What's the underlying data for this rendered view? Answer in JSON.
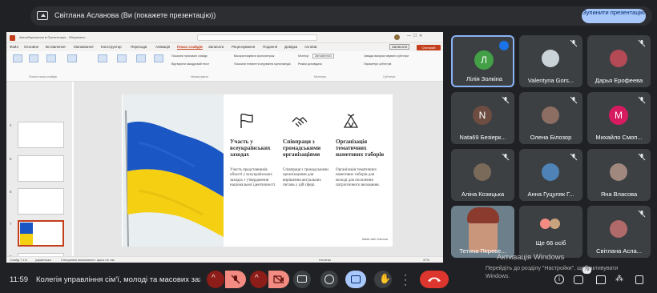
{
  "share_bar": {
    "presenter_text": "Світлана Асланова (Ви (покажете презентацію))",
    "stop_button": "Зупинити презентацію"
  },
  "powerpoint": {
    "title_text": "Автозбереження  ●  Презентація - Збережено",
    "menu": [
      "Файл",
      "Основне",
      "Вставлення",
      "Малювання",
      "Конструктор",
      "Переходи",
      "Анімація",
      "Показ слайдів",
      "Записати",
      "Рецензування",
      "Подання",
      "Довідка",
      "Acrobat"
    ],
    "active_menu": "Показ слайдів",
    "record_label": "Записати",
    "share_label": "Спільний доступ",
    "ribbon_groups": [
      "Почати показ слайдів",
      "Налаштувати",
      "Монітори",
      "Субтитри"
    ],
    "ribbon_options": [
      "Показати приховані слайди",
      "Використовувати хронометраж",
      "Монітор:",
      "Автоматично",
      "Завжди використовувати субтитри",
      "Відтворити закадровий текст",
      "Показати елементи керування мультимедіа",
      "Режим доповідача",
      "Параметри субтитрів"
    ],
    "status_left": "Слайд 7 з 8",
    "status_lang": "українська",
    "status_notes": "Нотатки",
    "status_access": "Спеціальні можливості: щось не так",
    "status_zoom": "47%",
    "thumb_numbers": [
      "4",
      "5",
      "6",
      "7",
      "8"
    ],
    "slide": {
      "columns": [
        {
          "icon": "flag-icon",
          "title": "Участь у всеукраїнських заходах",
          "body": "Участь представників області у всеукраїнських заходах з утвердження національної ідентичності."
        },
        {
          "icon": "handshake-icon",
          "title": "Співпраця з громадськими організаціями",
          "body": "Співпраця з громадськими організаціями для вирішення актуальних питань у цій сфері."
        },
        {
          "icon": "tent-icon",
          "title": "Організація тематичних наметових таборів",
          "body": "Організація тематичних наметових таборів для молоді для посилення патріотичного виховання."
        }
      ],
      "logo": "Made with Gamma"
    }
  },
  "participants": [
    {
      "name": "Лілія Золкіна",
      "initial": "Л",
      "avatar_color": "#43a047",
      "speaking": true
    },
    {
      "name": "Valentyna Gors...",
      "photo": true
    },
    {
      "name": "Дарья Ерофеева",
      "photo": true
    },
    {
      "name": "Nata69 Безіерк...",
      "initial": "N",
      "avatar_color": "#6d4c41"
    },
    {
      "name": "Олена Білозор",
      "photo": true
    },
    {
      "name": "Михайло Смоп...",
      "initial": "M",
      "avatar_color": "#d81b60"
    },
    {
      "name": "Аліна Козицька",
      "photo": true
    },
    {
      "name": "Анна Гуцуляк Г...",
      "photo": true
    },
    {
      "name": "Яна Власова",
      "photo": true
    },
    {
      "name": "Тетяна Переве...",
      "video": true
    },
    {
      "name": "Ще 66 осіб",
      "group": true
    },
    {
      "name": "Світлана Асла...",
      "photo": true
    }
  ],
  "bottom_bar": {
    "time": "11:59",
    "meeting_title": "Колегія управління сім'ї, молоді та масових зах...",
    "chat_badge": "79"
  },
  "windows_activation": {
    "title": "Активація Windows",
    "line1": "Перейдіть до розділу \"Настройки\", щоб активувати",
    "line2": "Windows."
  },
  "colors": {
    "meet_bg": "#202124",
    "tile_bg": "#3c4043",
    "stop_button": "#a8c7fa",
    "hangup": "#f28b82",
    "ppt_accent": "#c43e1c",
    "flag_blue": "#1a56c4",
    "flag_yellow": "#f5cf12"
  }
}
